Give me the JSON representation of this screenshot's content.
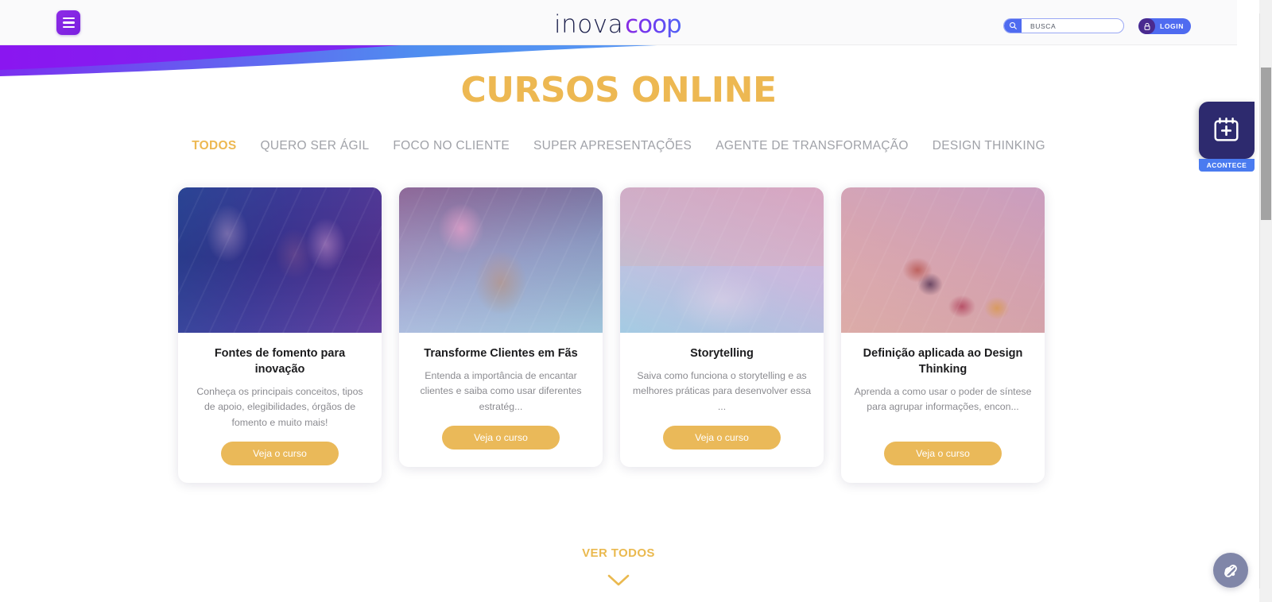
{
  "header": {
    "menu_icon": "hamburger-icon",
    "logo_part1": "inova",
    "logo_part2": "coop",
    "search": {
      "icon": "search-icon",
      "value": "BUSCA",
      "placeholder": "BUSCA"
    },
    "login": {
      "icon": "lock-icon",
      "label": "LOGIN"
    }
  },
  "main": {
    "page_title": "CURSOS ONLINE",
    "tabs": [
      {
        "label": "TODOS",
        "active": true
      },
      {
        "label": "QUERO SER ÁGIL",
        "active": false
      },
      {
        "label": "FOCO NO CLIENTE",
        "active": false
      },
      {
        "label": "SUPER APRESENTAÇÕES",
        "active": false
      },
      {
        "label": "AGENTE DE TRANSFORMAÇÃO",
        "active": false
      },
      {
        "label": "DESIGN THINKING",
        "active": false
      }
    ],
    "cards": [
      {
        "title": "Fontes de fomento para inovação",
        "description": "Conheça os principais conceitos, tipos de apoio, elegibilidades, órgãos de fomento e muito mais!",
        "button": "Veja o curso",
        "image_alt": "people-at-computers-photo"
      },
      {
        "title": "Transforme Clientes em Fãs",
        "description": "Entenda a importância de encantar clientes e saiba como usar diferentes estratég...",
        "button": "Veja o curso",
        "image_alt": "woman-holding-box-photo"
      },
      {
        "title": "Storytelling",
        "description": "Saiva como funciona o storytelling e as melhores práticas para desenvolver essa ...",
        "button": "Veja o curso",
        "image_alt": "hands-typing-keyboard-letters-photo"
      },
      {
        "title": "Definição aplicada ao Design Thinking",
        "description": "Aprenda a como usar o poder de síntese para agrupar informações, encon...",
        "button": "Veja o curso",
        "image_alt": "team-workshop-top-view-photo"
      }
    ],
    "see_all": "VER TODOS",
    "see_all_chevron": "chevron-down-icon"
  },
  "widgets": {
    "acontece": {
      "icon": "calendar-plus-icon",
      "label": "ACONTECE"
    },
    "accessibility_fab": {
      "icon": "accessibility-pill-icon"
    }
  },
  "colors": {
    "accent_gold": "#edb852",
    "brand_blue": "#4f6bf0",
    "brand_purple": "#8a2be2",
    "navy": "#2d2a6e",
    "muted_text": "#8b8b90"
  }
}
